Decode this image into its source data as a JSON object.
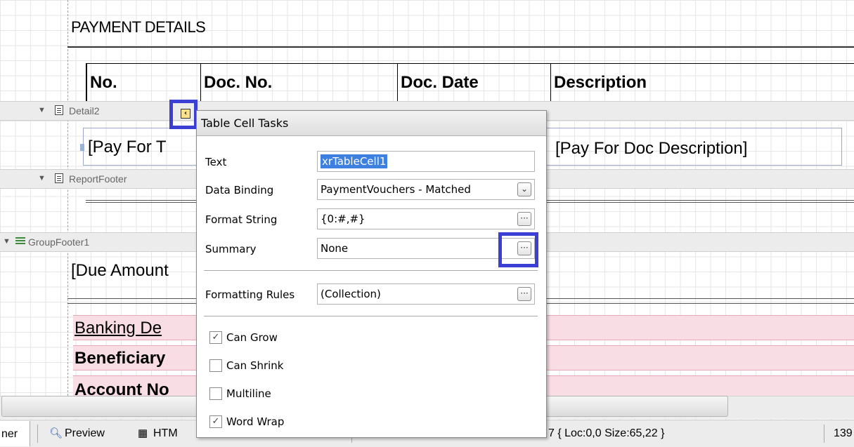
{
  "report": {
    "payment_details_title": "PAYMENT DETAILS",
    "columns": [
      "No.",
      "Doc. No.",
      "Doc. Date",
      "Description"
    ],
    "bands": {
      "detail": "Detail2",
      "report_footer": "ReportFooter",
      "group_footer": "GroupFooter1"
    },
    "detail_cells": {
      "pay_for": "[Pay For T",
      "pay_for_desc": "[Pay For Doc Description]"
    },
    "due_amount": "[Due Amount",
    "banking": {
      "title": "Banking De",
      "beneficiary": "Beneficiary",
      "account_no": "Account No"
    }
  },
  "smart_tag": {
    "icon": "chevron-left-icon"
  },
  "popup": {
    "title": "Table Cell Tasks",
    "fields": {
      "text_label": "Text",
      "text_value": "xrTableCell1",
      "data_binding_label": "Data Binding",
      "data_binding_value": "PaymentVouchers - Matched",
      "format_string_label": "Format String",
      "format_string_value": "{0:#,#}",
      "summary_label": "Summary",
      "summary_value": "None",
      "formatting_rules_label": "Formatting Rules",
      "formatting_rules_value": "(Collection)"
    },
    "ellipsis": "···",
    "checkboxes": {
      "can_grow": {
        "label": "Can Grow",
        "checked": true
      },
      "can_shrink": {
        "label": "Can Shrink",
        "checked": false
      },
      "multiline": {
        "label": "Multiline",
        "checked": false
      },
      "word_wrap": {
        "label": "Word Wrap",
        "checked": true
      }
    }
  },
  "statusbar": {
    "designer_tab": "ner",
    "preview_tab": "Preview",
    "html_tab": "HTM",
    "selection_info": "7 { Loc:0,0 Size:65,22 }",
    "zoom": "139"
  },
  "colors": {
    "highlight_outline": "#3b3fd4",
    "selection_bg": "#3d80df",
    "pink_band": "#f8dde4"
  }
}
